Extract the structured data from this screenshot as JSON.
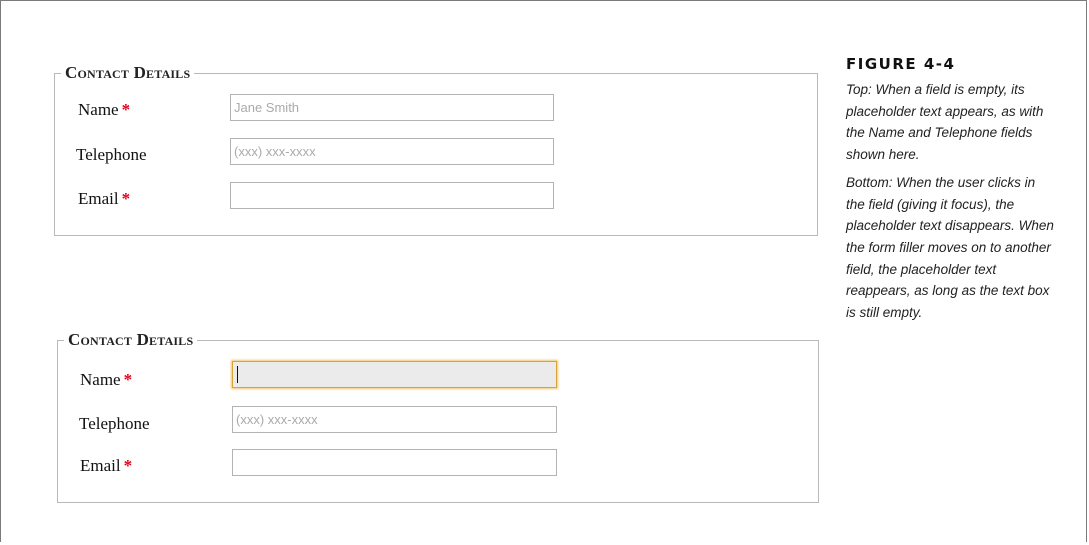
{
  "top_form": {
    "legend": "Contact Details",
    "fields": [
      {
        "label": "Name",
        "required": "*",
        "value": "",
        "placeholder": "Jane Smith"
      },
      {
        "label": "Telephone",
        "required": "",
        "value": "",
        "placeholder": "(xxx) xxx-xxxx"
      },
      {
        "label": "Email",
        "required": "*",
        "value": "",
        "placeholder": ""
      }
    ]
  },
  "bottom_form": {
    "legend": "Contact Details",
    "fields": [
      {
        "label": "Name",
        "required": "*",
        "value": "",
        "placeholder": "",
        "state": "focused"
      },
      {
        "label": "Telephone",
        "required": "",
        "value": "",
        "placeholder": "(xxx) xxx-xxxx"
      },
      {
        "label": "Email",
        "required": "*",
        "value": "",
        "placeholder": ""
      }
    ]
  },
  "caption": {
    "figure": "FIGURE 4-4",
    "top_text": "Top: When a field is empty, its placeholder text appears, as with the Name and Telephone fields shown here.",
    "bottom_text": "Bottom: When the user clicks in the field (giving it focus), the placeholder text disappears. When the form filler moves on to another field, the placeholder text reappears, as long as the text box is still empty."
  },
  "colors": {
    "required_marker": "#e2001a",
    "focus_border": "#d9a33a",
    "focused_background": "#ebebeb"
  }
}
